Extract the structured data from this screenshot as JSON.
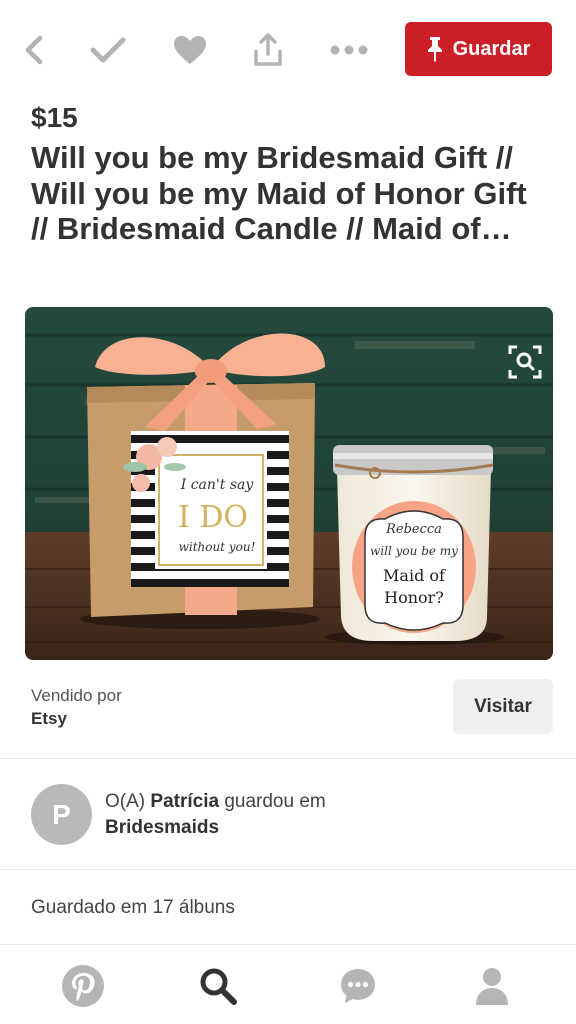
{
  "toolbar": {
    "back_icon": "chevron-left-icon",
    "check_icon": "check-icon",
    "like_icon": "heart-icon",
    "share_icon": "share-icon",
    "more_icon": "more-dots-icon",
    "save_label": "Guardar",
    "save_icon": "pin-icon",
    "accent_color": "#cb1f27"
  },
  "product": {
    "price": "$15",
    "title": "Will you be my Bridesmaid Gift // Will you be my Maid of Honor Gift // Bridesmaid Candle // Maid of…",
    "image": {
      "box_card_line1": "I can't say",
      "box_card_line2": "I DO",
      "box_card_line3": "without you!",
      "candle_label_line1": "Rebecca",
      "candle_label_line2": "will you be my",
      "candle_label_line3": "Maid of",
      "candle_label_line4": "Honor?"
    },
    "zoom_icon": "visual-search-icon"
  },
  "seller": {
    "sold_by_label": "Vendido por",
    "name": "Etsy",
    "visit_label": "Visitar"
  },
  "saver": {
    "avatar_initial": "P",
    "prefix": "O(A) ",
    "name": "Patrícia",
    "suffix": " guardou em",
    "board": "Bridesmaids"
  },
  "stats": {
    "saved_count_text": "Guardado em 17 álbuns"
  },
  "bottom_nav": {
    "items": [
      "pinterest-logo-icon",
      "search-icon",
      "chat-icon",
      "profile-icon"
    ]
  }
}
